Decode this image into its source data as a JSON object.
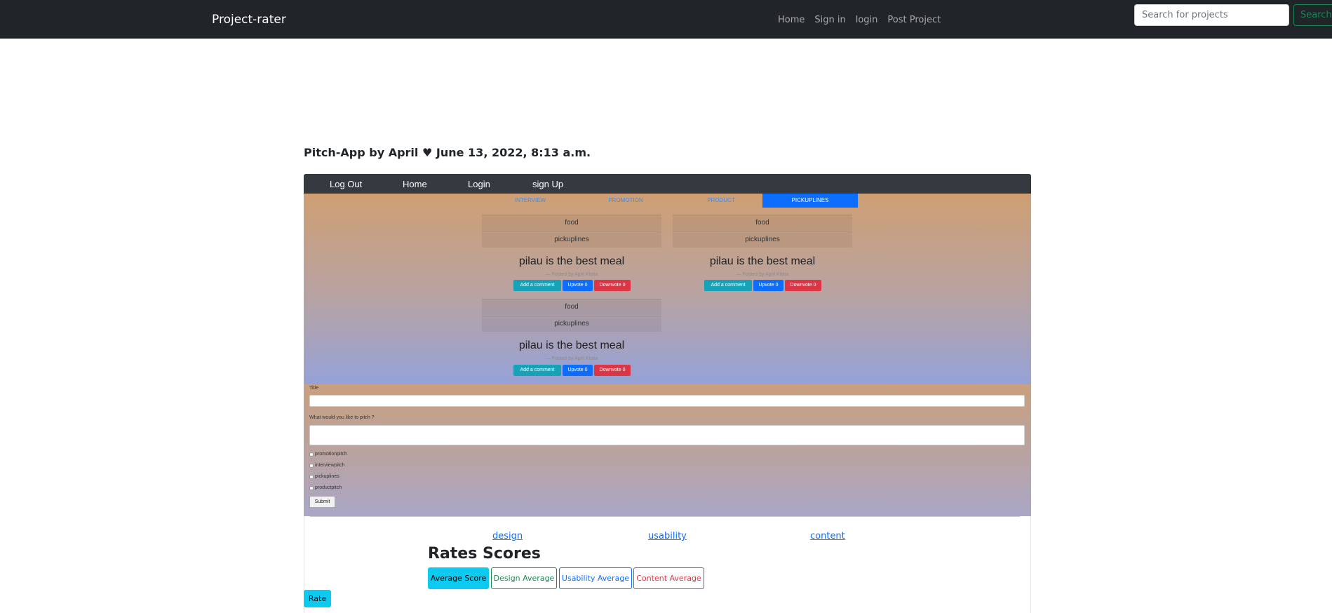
{
  "navbar": {
    "brand": "Project-rater",
    "links": [
      "Home",
      "Sign in",
      "login",
      "Post Project"
    ],
    "search_placeholder": "Search for projects",
    "search_button": "Search"
  },
  "post": {
    "title": "Pitch-App by April",
    "date": "June 13, 2022, 8:13 a.m."
  },
  "screenshot": {
    "nav": [
      "Log Out",
      "Home",
      "Login",
      "sign Up"
    ],
    "categories": [
      "INTERVIEW",
      "PROMOTION",
      "PRODUCT",
      "PICKUPLINES"
    ],
    "active_category": "PICKUPLINES",
    "cards": [
      {
        "category": "food",
        "subcategory": "pickuplines",
        "title": "pilau is the best meal",
        "meta": "— Posted by April Kisha",
        "comment": "Add a comment",
        "upvote": "Upvote 0",
        "downvote": "Downvote 0"
      },
      {
        "category": "food",
        "subcategory": "pickuplines",
        "title": "pilau is the best meal",
        "meta": "— Posted by April Kisha",
        "comment": "Add a comment",
        "upvote": "Upvote 0",
        "downvote": "Downvote 0"
      },
      {
        "category": "food",
        "subcategory": "pickuplines",
        "title": "pilau is the best meal",
        "meta": "— Posted by April Kisha",
        "comment": "Add a comment",
        "upvote": "Upvote 0",
        "downvote": "Downvote 0"
      }
    ],
    "form": {
      "title_label": "Title",
      "pitch_label": "What would you like to pitch ?",
      "options": [
        "promotionpitch",
        "interviewpitch",
        "pickuplines",
        "productpitch"
      ],
      "submit": "Submit"
    }
  },
  "rating": {
    "links": [
      "design",
      "usability",
      "content"
    ],
    "heading": "Rates Scores",
    "buttons": [
      "Average Score",
      "Design Average",
      "Usability Average",
      "Content Average"
    ],
    "rate_button": "Rate"
  }
}
